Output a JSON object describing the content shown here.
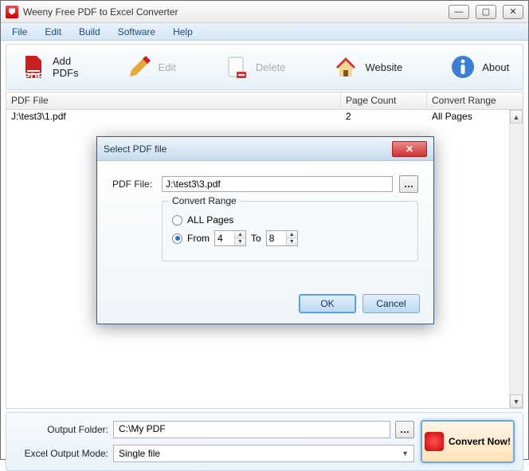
{
  "app": {
    "title": "Weeny Free PDF to Excel Converter"
  },
  "menu": {
    "file": "File",
    "edit": "Edit",
    "build": "Build",
    "software": "Software",
    "help": "Help"
  },
  "toolbar": {
    "add": "Add PDFs",
    "edit": "Edit",
    "delete": "Delete",
    "website": "Website",
    "about": "About"
  },
  "columns": {
    "pdf": "PDF File",
    "pagecount": "Page Count",
    "range": "Convert Range"
  },
  "rows": [
    {
      "pdf": "J:\\test3\\1.pdf",
      "pagecount": "2",
      "range": "All Pages"
    }
  ],
  "bottom": {
    "output_label": "Output Folder:",
    "output_value": "C:\\My PDF",
    "mode_label": "Excel Output Mode:",
    "mode_value": "Single file",
    "convert": "Convert Now!"
  },
  "dialog": {
    "title": "Select PDF file",
    "file_label": "PDF File:",
    "file_value": "J:\\test3\\3.pdf",
    "group_title": "Convert Range",
    "all_label": "ALL Pages",
    "from_label": "From",
    "from_value": "4",
    "to_label": "To",
    "to_value": "8",
    "ok": "OK",
    "cancel": "Cancel"
  }
}
